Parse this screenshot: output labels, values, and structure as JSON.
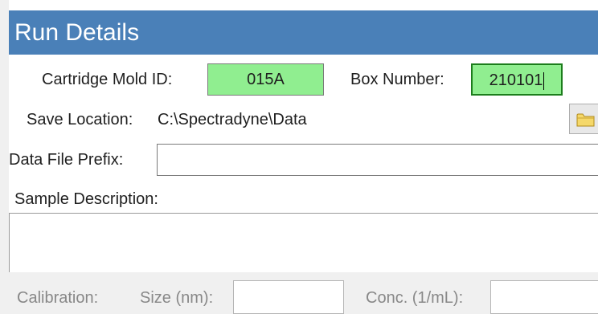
{
  "panel": {
    "title": "Run Details",
    "cartridge_mold": {
      "label": "Cartridge Mold ID:",
      "value": "015A"
    },
    "box_number": {
      "label": "Box Number:",
      "value": "210101"
    },
    "save_location": {
      "label": "Save Location:",
      "path": "C:\\Spectradyne\\Data",
      "browse_icon": "folder-icon"
    },
    "data_file_prefix": {
      "label": "Data File Prefix:",
      "value": ""
    },
    "sample_description": {
      "label": "Sample Description:",
      "value": ""
    },
    "calibration": {
      "label": "Calibration:",
      "size_label": "Size (nm):",
      "size_value": "",
      "conc_label": "Conc. (1/mL):",
      "conc_value": ""
    }
  },
  "colors": {
    "title_bar": "#4a80b8",
    "field_valid": "#90ee90",
    "disabled_text": "#888888"
  }
}
